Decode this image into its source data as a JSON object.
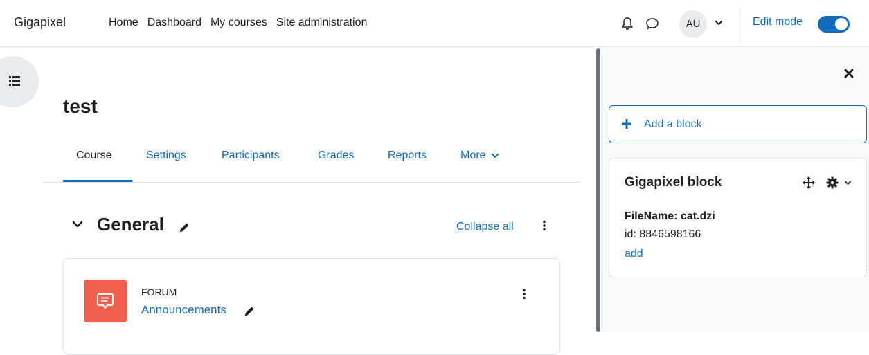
{
  "navbar": {
    "brand": "Gigapixel",
    "links": [
      "Home",
      "Dashboard",
      "My courses",
      "Site administration"
    ],
    "avatar_initials": "AU",
    "edit_mode_label": "Edit mode",
    "edit_mode_on": true
  },
  "course": {
    "title": "test",
    "tabs": [
      "Course",
      "Settings",
      "Participants",
      "Grades",
      "Reports",
      "More"
    ],
    "active_tab": "Course"
  },
  "section": {
    "title": "General",
    "collapse_all": "Collapse all"
  },
  "activity": {
    "type": "FORUM",
    "name": "Announcements"
  },
  "drawer": {
    "add_block": "Add a block",
    "block": {
      "title": "Gigapixel block",
      "filename": "FileName: cat.dzi",
      "id": "id: 8846598166",
      "link": "add"
    }
  },
  "colors": {
    "accent": "#0f6cbf",
    "forum_icon_bg": "#f0604d",
    "drawer_bg": "#f8f9fa"
  },
  "icons": [
    "bell-icon",
    "chat-icon",
    "chevron-down-icon",
    "list-icon",
    "pencil-icon",
    "kebab-icon",
    "forum-icon",
    "close-icon",
    "plus-icon",
    "move-icon",
    "gear-icon"
  ]
}
